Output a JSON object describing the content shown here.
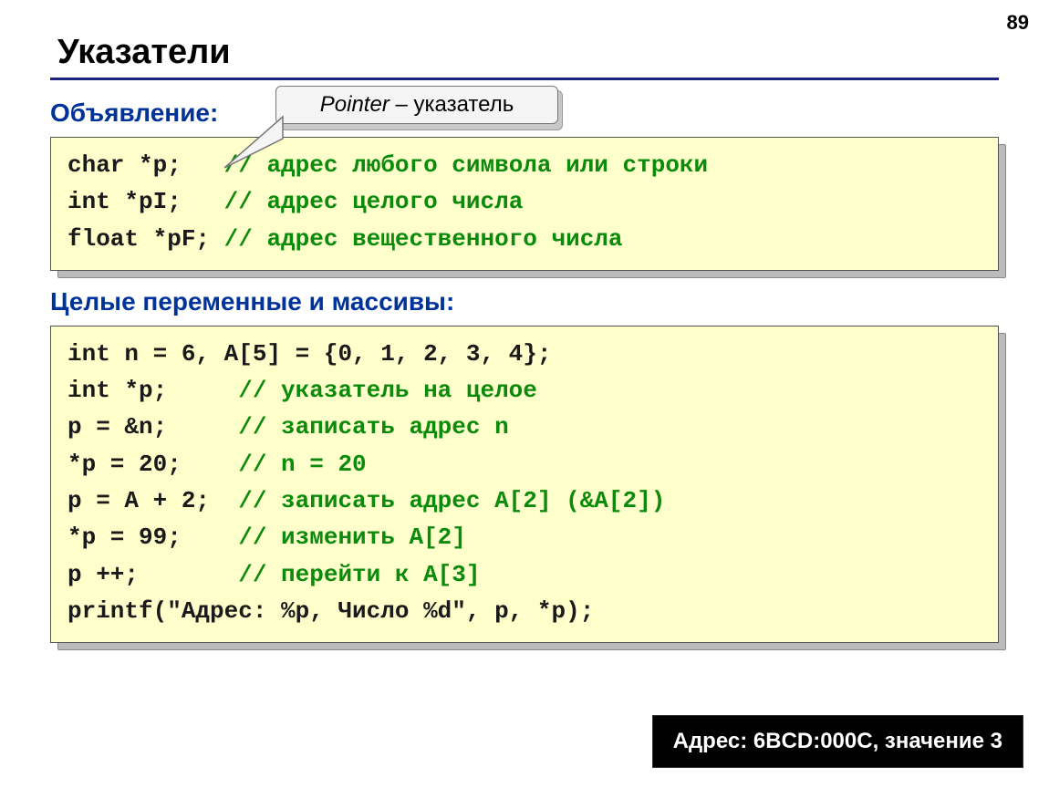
{
  "page_number": "89",
  "title": "Указатели",
  "callout": {
    "italic": "Pointer",
    "rest": " – указатель"
  },
  "sub1": "Объявление:",
  "box1": {
    "lines": [
      {
        "code": "char *p;   ",
        "comment": "// адрес любого символа или строки"
      },
      {
        "code": "int *pI;   ",
        "comment": "// адрес целого числа"
      },
      {
        "code": "float *pF; ",
        "comment": "// адрес вещественного числа"
      }
    ]
  },
  "sub2": "Целые переменные и массивы:",
  "box2": {
    "lines": [
      {
        "code": "int n = 6, A[5] = {0, 1, 2, 3, 4};",
        "comment": ""
      },
      {
        "code": "int *p;     ",
        "comment": "// указатель на целое"
      },
      {
        "code": "p = &n;     ",
        "comment": "// записать адрес n"
      },
      {
        "code": "*p = 20;    ",
        "comment": "// n = 20"
      },
      {
        "code": "p = A + 2;  ",
        "comment": "// записать адрес A[2] (&A[2])"
      },
      {
        "code": "*p = 99;    ",
        "comment": "// изменить A[2]"
      },
      {
        "code": "p ++;       ",
        "comment": "// перейти к A[3]"
      },
      {
        "code": "printf(\"Адрес: %p, Число %d\", p, *p);",
        "comment": ""
      }
    ]
  },
  "output_box": "Адрес: 6BCD:000C, значение 3"
}
